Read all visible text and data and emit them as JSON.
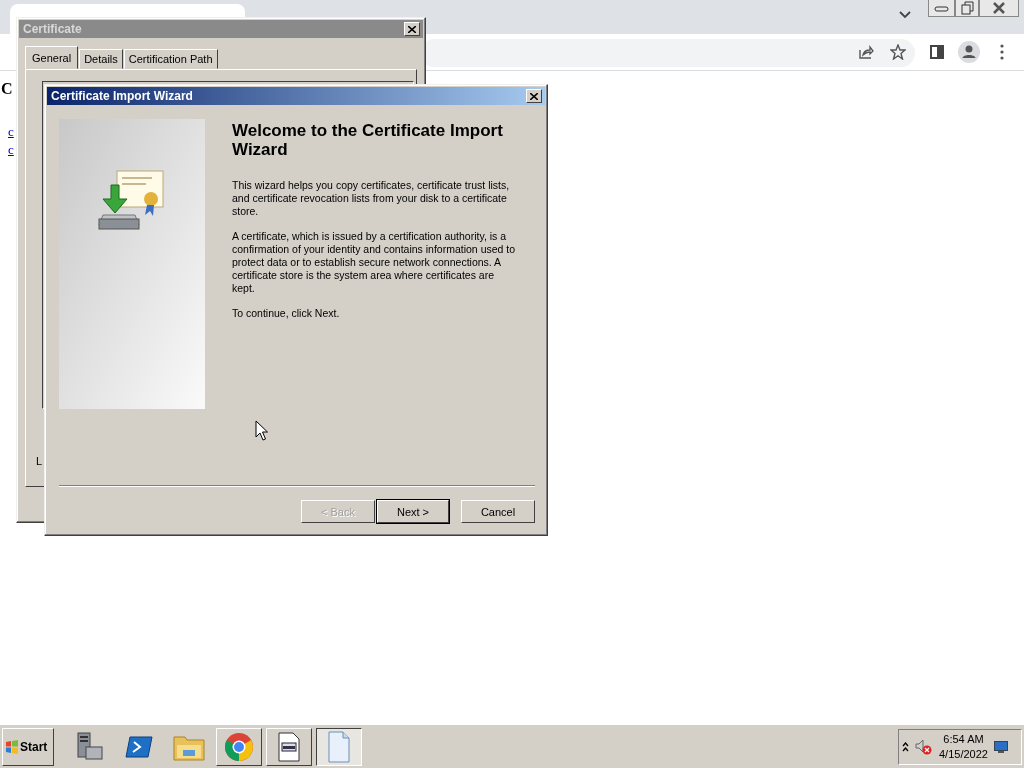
{
  "browser": {
    "page_fragments": [
      {
        "kind": "heading",
        "text": "C"
      },
      {
        "kind": "link",
        "text": "c"
      },
      {
        "kind": "link",
        "text": "c"
      }
    ]
  },
  "certificate_window": {
    "title": "Certificate",
    "tabs": [
      {
        "label": "General",
        "selected": true
      },
      {
        "label": "Details",
        "selected": false
      },
      {
        "label": "Certification Path",
        "selected": false
      }
    ],
    "footer_fragment": "L"
  },
  "wizard": {
    "title": "Certificate Import Wizard",
    "heading": "Welcome to the Certificate Import Wizard",
    "paragraphs": [
      "This wizard helps you copy certificates, certificate trust lists, and certificate revocation lists from your disk to a certificate store.",
      "A certificate, which is issued by a certification authority, is a confirmation of your identity and contains information used to protect data or to establish secure network connections. A certificate store is the system area where certificates are kept.",
      "To continue, click Next."
    ],
    "buttons": [
      {
        "label": "< Back",
        "disabled": true,
        "default": false
      },
      {
        "label": "Next >",
        "disabled": false,
        "default": true
      },
      {
        "label": "Cancel",
        "disabled": false,
        "default": false
      }
    ]
  },
  "taskbar": {
    "start_label": "Start",
    "apps": [
      {
        "kind": "server",
        "running": false,
        "selected": false
      },
      {
        "kind": "shell",
        "running": false,
        "selected": false
      },
      {
        "kind": "folder",
        "running": false,
        "selected": false
      },
      {
        "kind": "browser",
        "running": true,
        "selected": false
      },
      {
        "kind": "window",
        "running": true,
        "selected": false
      },
      {
        "kind": "document",
        "running": true,
        "selected": true
      }
    ],
    "clock_time": "6:54 AM",
    "clock_date": "4/15/2022"
  }
}
